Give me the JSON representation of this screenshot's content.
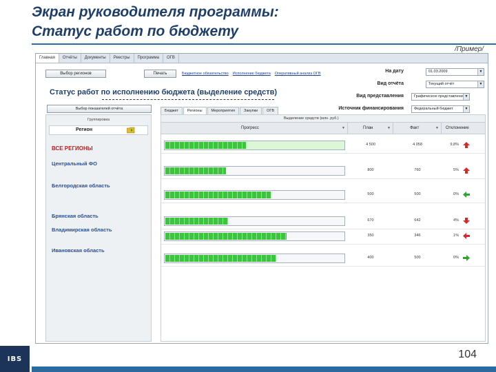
{
  "slide": {
    "title_line1": "Экран руководителя программы:",
    "title_line2": "Статус работ по бюджету",
    "example_note": "/Пример/",
    "page_number": "104",
    "logo_text": "IBS",
    "accent_color": "#2b6a9e",
    "title_color": "#1f3f6a"
  },
  "app": {
    "tabs": [
      "Главная",
      "Отчёты",
      "Документы",
      "Реестры",
      "Программа",
      "ОГВ"
    ],
    "active_tab": 0,
    "select_region_button": "Выбор регионов",
    "print_button": "Печать",
    "links": [
      "Бюджетное обязательство",
      "Исполнение бюджета",
      "Оперативный анализ ОГВ"
    ],
    "report_title": "Статус работ по исполнению бюджета (выделение средств)",
    "expand_button": "Выбор показателей отчёта",
    "filters": [
      {
        "label": "На дату",
        "value": "01.03.2009"
      },
      {
        "label": "Вид отчёта",
        "value": "Текущий отчёт"
      },
      {
        "label": "Вид представления",
        "value": "Графическое представление"
      },
      {
        "label": "Источник финансирования",
        "value": "Федеральный бюджет"
      }
    ],
    "subtabs": [
      "Бюджет",
      "Регионы",
      "Мероприятия",
      "Закупки",
      "ОГВ"
    ],
    "active_subtab": 1,
    "left_panel": {
      "group_label": "Группировка",
      "column_header": "Регион",
      "folder_icon": "folder-icon"
    },
    "grid": {
      "top_label": "Выделение средств (млн. руб.)",
      "columns": {
        "progress": "Прогресс",
        "plan": "План",
        "fact": "Факт",
        "deviation": "Отклонение"
      }
    },
    "rows": [
      {
        "region": "ВСЕ РЕГИОНЫ",
        "progress": 0.45,
        "plan": "4 500",
        "fact": "4 058",
        "deviation": "9,8%",
        "trend": "up",
        "trend_color": "#d42a2a",
        "highlight": true,
        "is_total": true
      },
      {
        "region": "Центральный ФО",
        "progress": 0.34,
        "plan": "800",
        "fact": "760",
        "deviation": "5%",
        "trend": "up",
        "trend_color": "#d42a2a",
        "highlight": false,
        "is_total": false
      },
      {
        "region": "Белгородская область",
        "progress": 0.59,
        "plan": "500",
        "fact": "500",
        "deviation": "0%",
        "trend": "left",
        "trend_color": "#2ea32e",
        "highlight": false,
        "is_total": false
      },
      {
        "region": "Брянская область",
        "progress": 0.35,
        "plan": "670",
        "fact": "642",
        "deviation": "4%",
        "trend": "down",
        "trend_color": "#d42a2a",
        "highlight": false,
        "is_total": false
      },
      {
        "region": "Владимирская область",
        "progress": 0.68,
        "plan": "350",
        "fact": "346",
        "deviation": "1%",
        "trend": "left",
        "trend_color": "#d42a2a",
        "highlight": false,
        "is_total": false
      },
      {
        "region": "Ивановская область",
        "progress": 0.62,
        "plan": "400",
        "fact": "500",
        "deviation": "0%",
        "trend": "right",
        "trend_color": "#2ea32e",
        "highlight": false,
        "is_total": false
      }
    ]
  }
}
